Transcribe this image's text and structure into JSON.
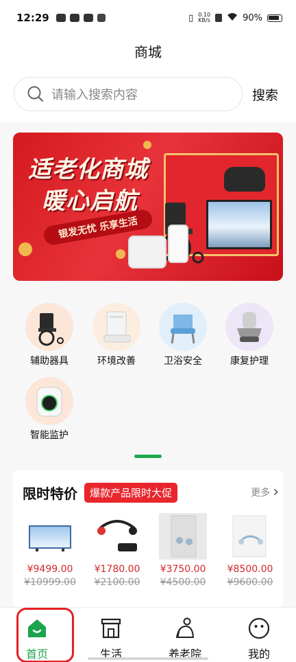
{
  "status": {
    "time": "12:29",
    "speed_top": "0.10",
    "speed_bottom": "KB/s",
    "battery": "90%"
  },
  "header": {
    "title": "商城"
  },
  "search": {
    "placeholder": "请输入搜索内容",
    "button_label": "搜索"
  },
  "banner": {
    "line1": "适老化商城",
    "line2": "暖心启航",
    "slogan": "银发无忧 乐享生活"
  },
  "categories": [
    {
      "label": "辅助器具",
      "icon": "wheelchair-icon",
      "bg": "#fbe6d8"
    },
    {
      "label": "环境改善",
      "icon": "purifier-icon",
      "bg": "#fbeedf"
    },
    {
      "label": "卫浴安全",
      "icon": "bath-chair-icon",
      "bg": "#e0effa"
    },
    {
      "label": "康复护理",
      "icon": "massage-chair-icon",
      "bg": "#ece6f7"
    },
    {
      "label": "智能监护",
      "icon": "monitor-device-icon",
      "bg": "#fbe6d8"
    }
  ],
  "flash_sale": {
    "title": "限时特价",
    "tag": "爆款产品限时大促",
    "more": "更多",
    "products": [
      {
        "price": "¥9499.00",
        "original_price": "¥10999.00",
        "icon": "tv-icon"
      },
      {
        "price": "¥1780.00",
        "original_price": "¥2100.00",
        "icon": "bone-headphone-icon"
      },
      {
        "price": "¥3750.00",
        "original_price": "¥4500.00",
        "icon": "hearing-aid-box-icon"
      },
      {
        "price": "¥8500.00",
        "original_price": "¥9600.00",
        "icon": "hearing-aid-icon"
      }
    ]
  },
  "tabs": [
    {
      "label": "首页",
      "icon": "home-icon",
      "active": true
    },
    {
      "label": "生活",
      "icon": "shop-icon",
      "active": false
    },
    {
      "label": "养老院",
      "icon": "elder-icon",
      "active": false
    },
    {
      "label": "我的",
      "icon": "profile-face-icon",
      "active": false
    }
  ],
  "colors": {
    "accent_green": "#1da34b",
    "price_red": "#d4262c",
    "tag_red": "#e8262c"
  }
}
